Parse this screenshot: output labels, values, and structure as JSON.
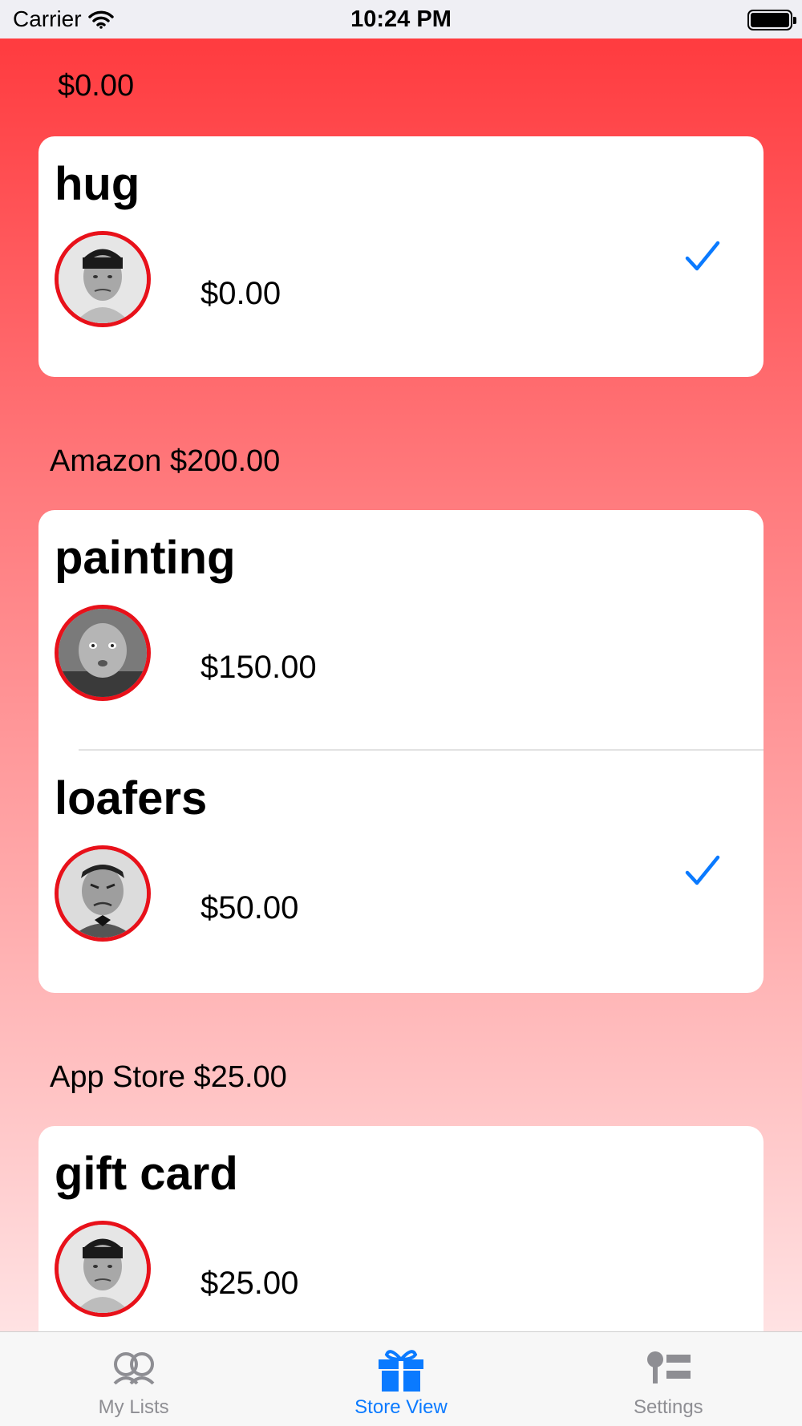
{
  "status_bar": {
    "carrier": "Carrier",
    "time": "10:24 PM"
  },
  "sections": [
    {
      "header": "$0.00",
      "items": [
        {
          "title": "hug",
          "price": "$0.00",
          "checked": true,
          "avatar": "moe-avatar"
        }
      ]
    },
    {
      "header": "Amazon $200.00",
      "items": [
        {
          "title": "painting",
          "price": "$150.00",
          "checked": false,
          "avatar": "curly-avatar"
        },
        {
          "title": "loafers",
          "price": "$50.00",
          "checked": true,
          "avatar": "shemp-avatar"
        }
      ]
    },
    {
      "header": "App Store $25.00",
      "items": [
        {
          "title": "gift card",
          "price": "$25.00",
          "checked": false,
          "avatar": "moe-avatar"
        }
      ]
    }
  ],
  "tab_bar": {
    "tabs": [
      {
        "label": "My Lists",
        "icon": "people-icon",
        "active": false
      },
      {
        "label": "Store View",
        "icon": "gift-icon",
        "active": true
      },
      {
        "label": "Settings",
        "icon": "settings-list-icon",
        "active": false
      }
    ]
  },
  "colors": {
    "accent": "#0a7aff",
    "avatar_border": "#e8111a",
    "gradient_top": "#ff3b3f",
    "gradient_bottom": "#ffe2e3",
    "inactive_tab": "#8e8e93"
  }
}
